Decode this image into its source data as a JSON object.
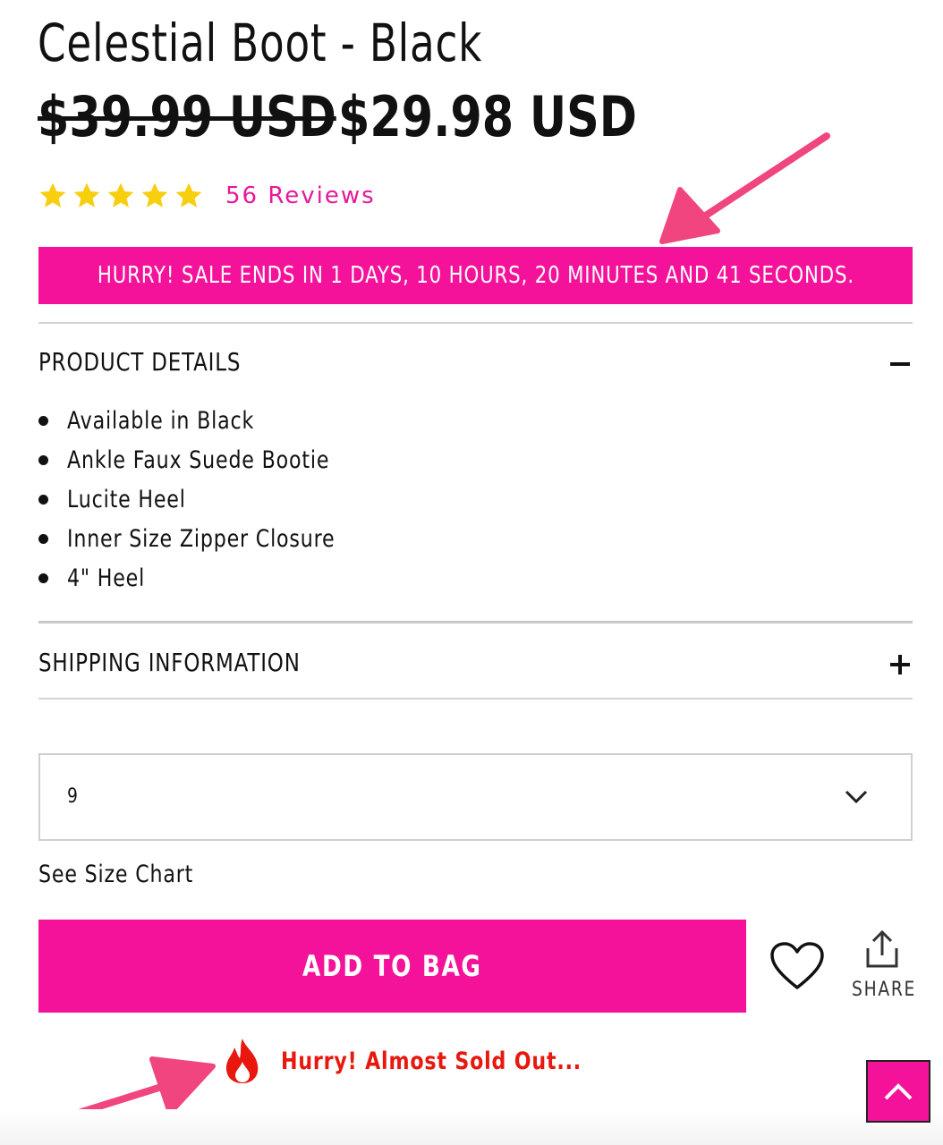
{
  "product": {
    "title": "Celestial Boot - Black",
    "old_price": "$39.99 USD",
    "new_price": "$29.98 USD",
    "rating": {
      "stars": 5,
      "reviews_label": "56 Reviews"
    }
  },
  "sale_banner": {
    "text": "HURRY! SALE ENDS IN 1 DAYS, 10 HOURS, 20 MINUTES AND 41 SECONDS."
  },
  "sections": {
    "details": {
      "label": "PRODUCT DETAILS",
      "toggle_icon": "minus-icon",
      "items": [
        "Available in Black",
        "Ankle Faux Suede Bootie",
        "Lucite Heel",
        "Inner Size Zipper Closure",
        "4\" Heel"
      ]
    },
    "shipping": {
      "label": "SHIPPING INFORMATION",
      "toggle_icon": "plus-icon"
    }
  },
  "size_select": {
    "value": "9",
    "icon": "chevron-down-icon"
  },
  "size_chart_link": "See Size Chart",
  "actions": {
    "add_to_bag": "ADD TO BAG",
    "wishlist_icon": "heart-icon",
    "share_label": "SHARE",
    "share_icon": "share-icon"
  },
  "urgency": {
    "text": "Hurry! Almost Sold Out...",
    "icon": "fire-icon"
  },
  "back_to_top_icon": "chevron-up-icon",
  "colors": {
    "accent_pink": "#f4129b",
    "review_pink": "#e6199a",
    "urgency_red": "#e8180f",
    "star_yellow": "#f7cf0f",
    "annotation_arrow": "#f0457f"
  }
}
